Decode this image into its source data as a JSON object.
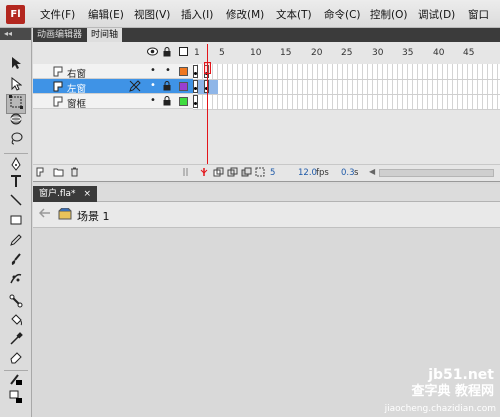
{
  "app": {
    "logo_text": "Fl",
    "menu": [
      "文件(F)",
      "编辑(E)",
      "视图(V)",
      "插入(I)",
      "修改(M)",
      "文本(T)",
      "命令(C)",
      "控制(O)",
      "调试(D)",
      "窗口"
    ]
  },
  "tools_panel": {
    "collapse_glyph": "◂◂"
  },
  "panel_tabs": [
    "动画编辑器",
    "时间轴"
  ],
  "timeline": {
    "header_icons": [
      "eye-icon",
      "lock-icon",
      "outline-icon"
    ],
    "ruler": [
      "1",
      "5",
      "10",
      "15",
      "20",
      "25",
      "30",
      "35",
      "40",
      "45"
    ],
    "layers": [
      {
        "name": "右窗",
        "color": "#f07820",
        "selected": false
      },
      {
        "name": "左窗",
        "color": "#9a3fd0",
        "selected": true
      },
      {
        "name": "窗框",
        "color": "#3fdc3f",
        "selected": false
      }
    ],
    "footer": {
      "current_frame": "5",
      "fps": "12.0",
      "fps_unit": "fps",
      "time": "0.3",
      "time_unit": "s"
    }
  },
  "document": {
    "tab_label": "窗户.fla*",
    "close_glyph": "×",
    "scene_label": "场景 1"
  },
  "watermark": {
    "top": "jb51.net",
    "mid": "查字典 教程网",
    "bot": "jiaocheng.chazidian.com"
  }
}
